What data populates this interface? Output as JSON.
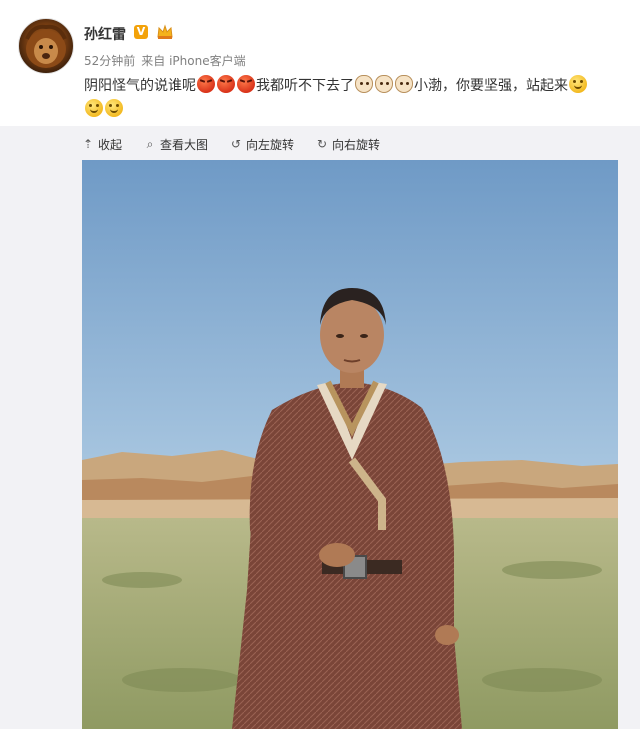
{
  "post": {
    "username": "孙红雷",
    "verified_badge": "V",
    "crown_icon": "crown-icon",
    "meta_time": "52分钟前",
    "meta_source": "来自 iPhone客户端",
    "text_part1": "阴阳怪气的说谁呢",
    "text_part2": "我都听不下去了",
    "text_part3": "小渤，你要坚强，站起来",
    "emoji_icons": [
      "angry-face-icon",
      "cat-face-icon",
      "smile-face-icon"
    ]
  },
  "toolbar": {
    "collapse": "收起",
    "view_large": "查看大图",
    "rotate_left": "向左旋转",
    "rotate_right": "向右旋转",
    "icons": [
      "collapse-up-icon",
      "magnifier-icon",
      "rotate-left-icon",
      "rotate-right-icon"
    ]
  },
  "colors": {
    "verified": "#f3a20a",
    "sky_top": "#7ea6cf",
    "robe": "#7a4538",
    "grass": "#a9ad7a"
  }
}
